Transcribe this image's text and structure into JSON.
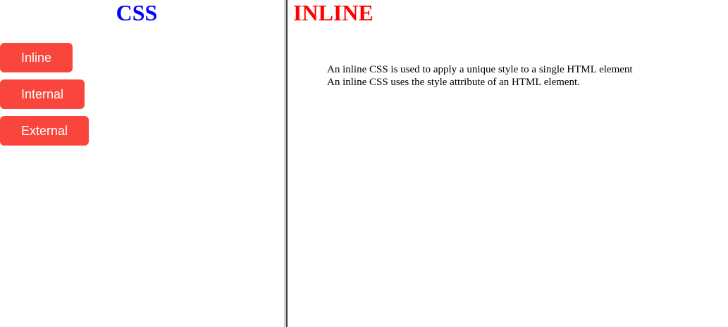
{
  "left": {
    "title": "CSS",
    "buttons": [
      {
        "label": "Inline"
      },
      {
        "label": "Internal"
      },
      {
        "label": "External"
      }
    ]
  },
  "right": {
    "title": "INLINE",
    "lines": [
      "An inline CSS is used to apply a unique style to a single HTML element",
      "An inline CSS uses the style attribute of an HTML element."
    ]
  },
  "colors": {
    "left_title": "#0000ff",
    "right_title": "#ff0000",
    "button_bg": "#f9453b",
    "button_text": "#ffffff"
  }
}
